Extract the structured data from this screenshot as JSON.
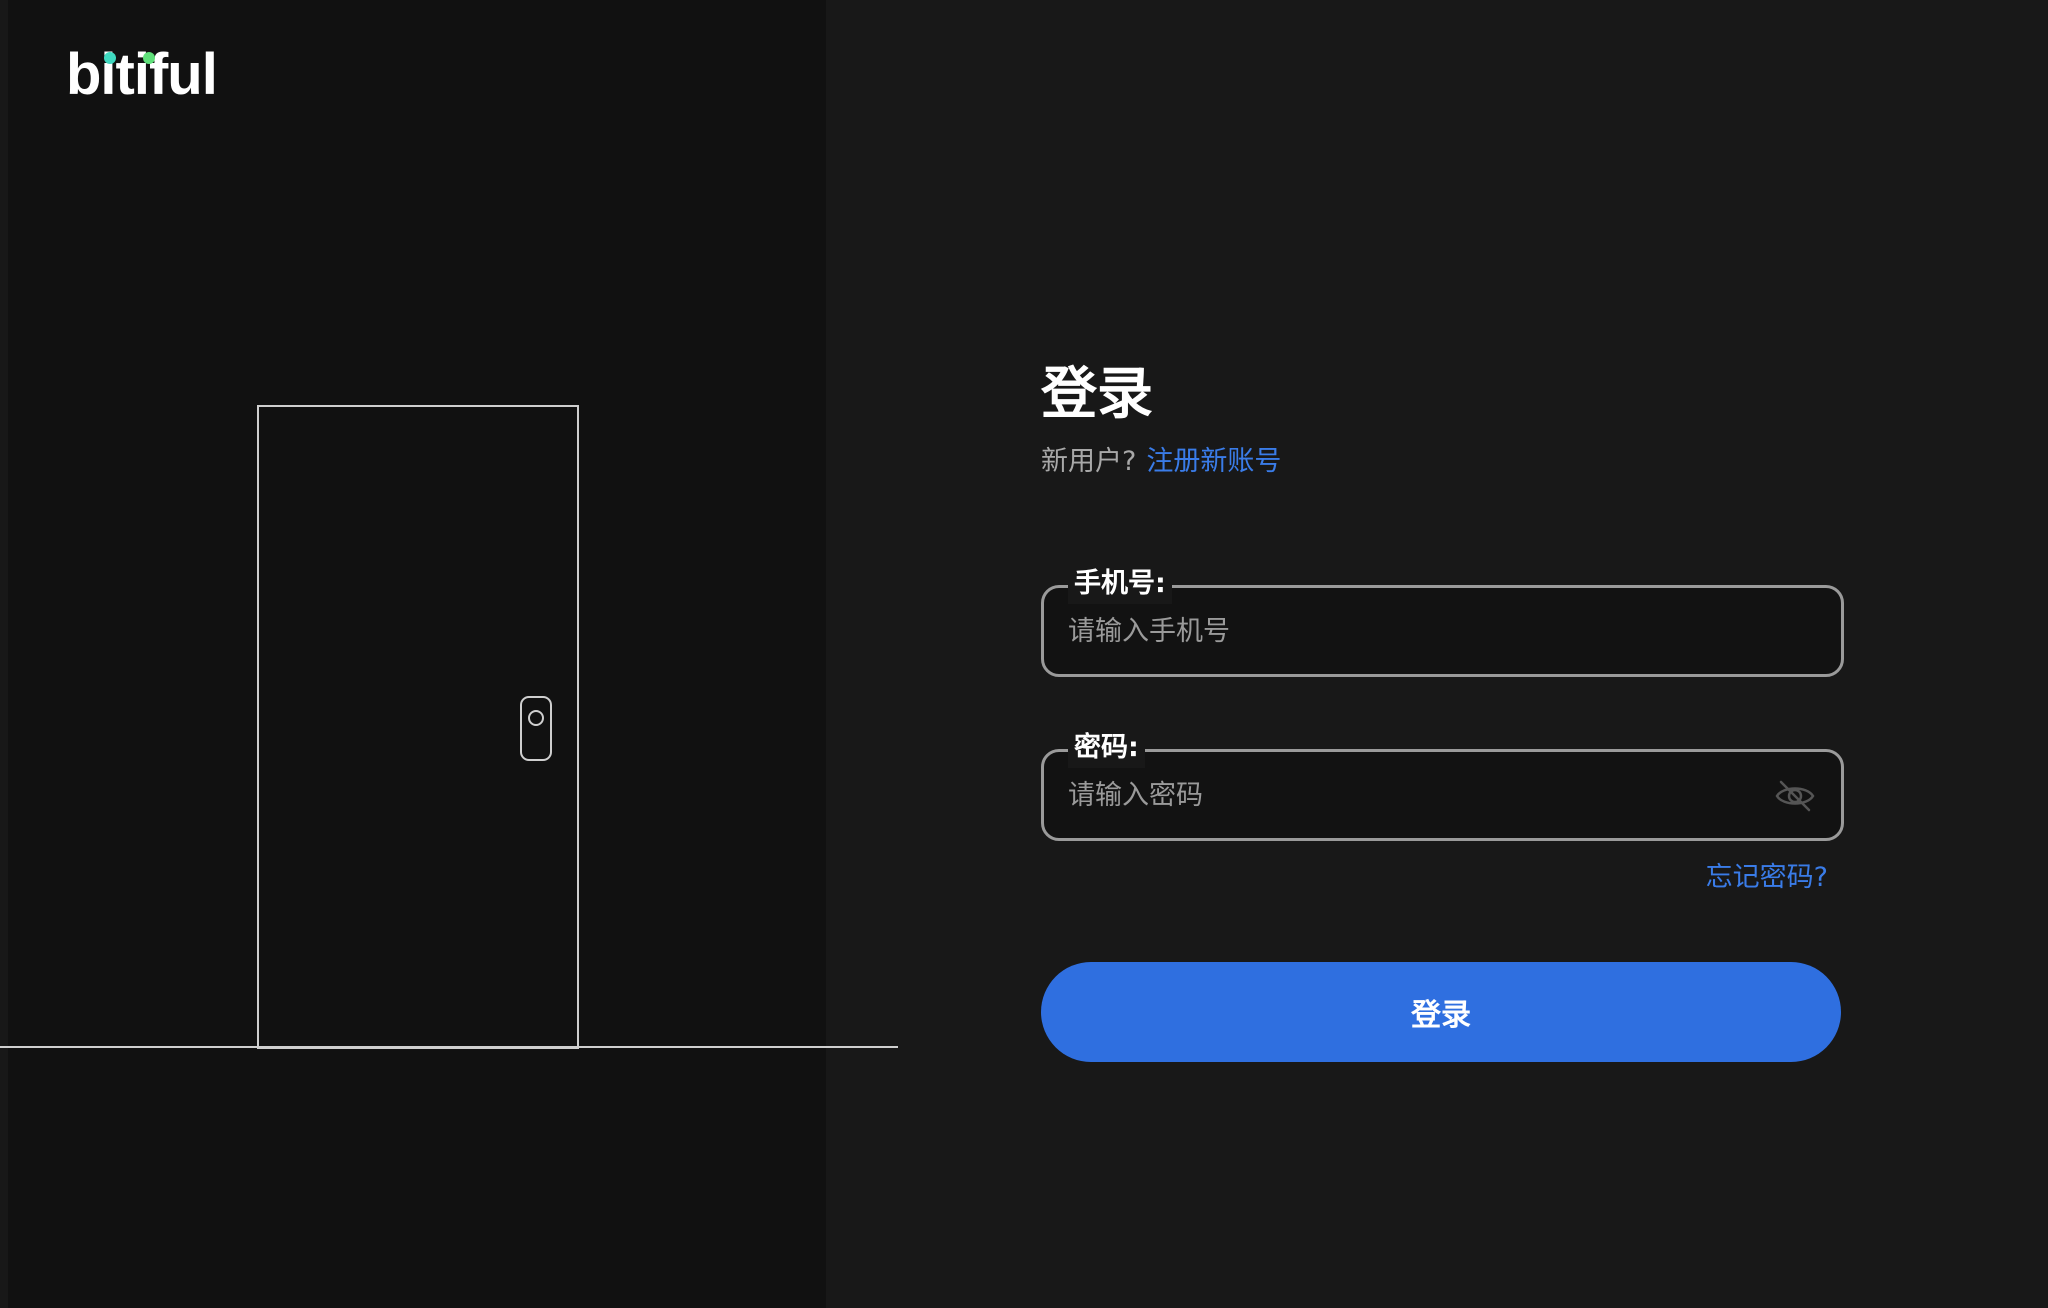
{
  "brand": {
    "name": "bitiful",
    "dot_colors": [
      "#3fd9c0",
      "#5fe07a"
    ]
  },
  "login": {
    "title": "登录",
    "new_user_prompt": "新用户?",
    "register_link": "注册新账号",
    "phone": {
      "label": "手机号:",
      "placeholder": "请输入手机号",
      "value": ""
    },
    "password": {
      "label": "密码:",
      "placeholder": "请输入密码",
      "value": "",
      "visibility_icon": "eye-off-icon"
    },
    "forgot_password": "忘记密码?",
    "submit_label": "登录"
  },
  "colors": {
    "accent": "#2f6fe0",
    "link": "#3a7ce8",
    "background": "#181818",
    "panel": "#111111"
  }
}
